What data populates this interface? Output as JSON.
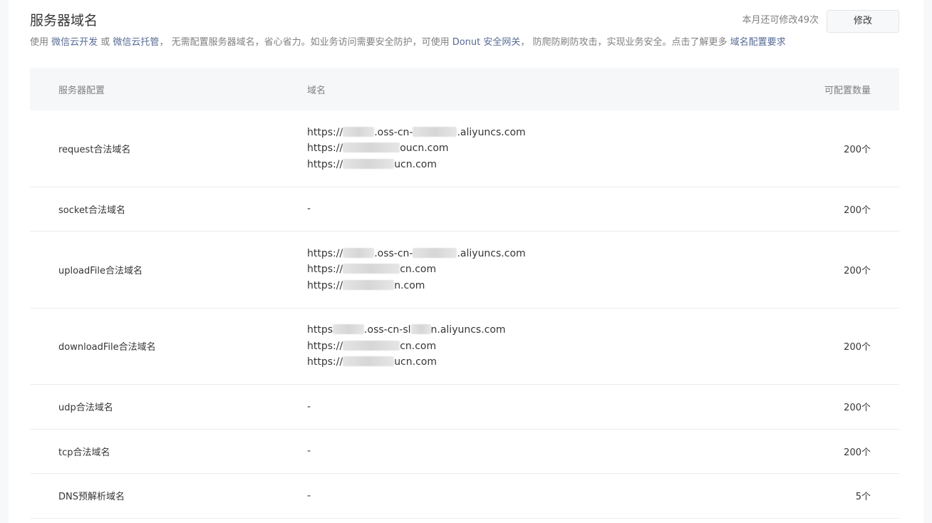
{
  "header": {
    "title": "服务器域名",
    "quota_text": "本月还可修改49次",
    "edit_button": "修改"
  },
  "description": {
    "p1": "使用 ",
    "link_cloud_dev": "微信云开发",
    "p2": " 或 ",
    "link_cloud_hosting": "微信云托管",
    "p3": "， 无需配置服务器域名，省心省力。如业务访问需要安全防护，可使用 ",
    "link_donut": "Donut 安全网关",
    "p4": "， 防爬防刷防攻击，实现业务安全。点击了解更多 ",
    "link_requirements": "域名配置要求"
  },
  "table": {
    "headers": {
      "config": "服务器配置",
      "domain": "域名",
      "count": "可配置数量"
    },
    "rows": [
      {
        "name": "request合法域名",
        "domains": [
          {
            "prefix": "https://",
            "suffix": ".oss-cn-",
            "tail": ".aliyuncs.com"
          },
          {
            "prefix": "https://",
            "suffix": "",
            "tail": "oucn.com"
          },
          {
            "prefix": "https://",
            "suffix": "",
            "tail": "ucn.com"
          }
        ],
        "count": "200个"
      },
      {
        "name": "socket合法域名",
        "domains": "-",
        "count": "200个"
      },
      {
        "name": "uploadFile合法域名",
        "domains": [
          {
            "prefix": "https://",
            "suffix": ".oss-cn-",
            "tail": ".aliyuncs.com"
          },
          {
            "prefix": "https://",
            "suffix": "",
            "tail": "cn.com"
          },
          {
            "prefix": "https://",
            "suffix": "",
            "tail": "n.com"
          }
        ],
        "count": "200个"
      },
      {
        "name": "downloadFile合法域名",
        "domains": [
          {
            "prefix": "https",
            "suffix": ".oss-cn-sl",
            "tail": "n.aliyuncs.com"
          },
          {
            "prefix": "https://",
            "suffix": "",
            "tail": "cn.com"
          },
          {
            "prefix": "https://",
            "suffix": "",
            "tail": "ucn.com"
          }
        ],
        "count": "200个"
      },
      {
        "name": "udp合法域名",
        "domains": "-",
        "count": "200个"
      },
      {
        "name": "tcp合法域名",
        "domains": "-",
        "count": "200个"
      },
      {
        "name": "DNS预解析域名",
        "domains": "-",
        "count": "5个"
      }
    ]
  }
}
